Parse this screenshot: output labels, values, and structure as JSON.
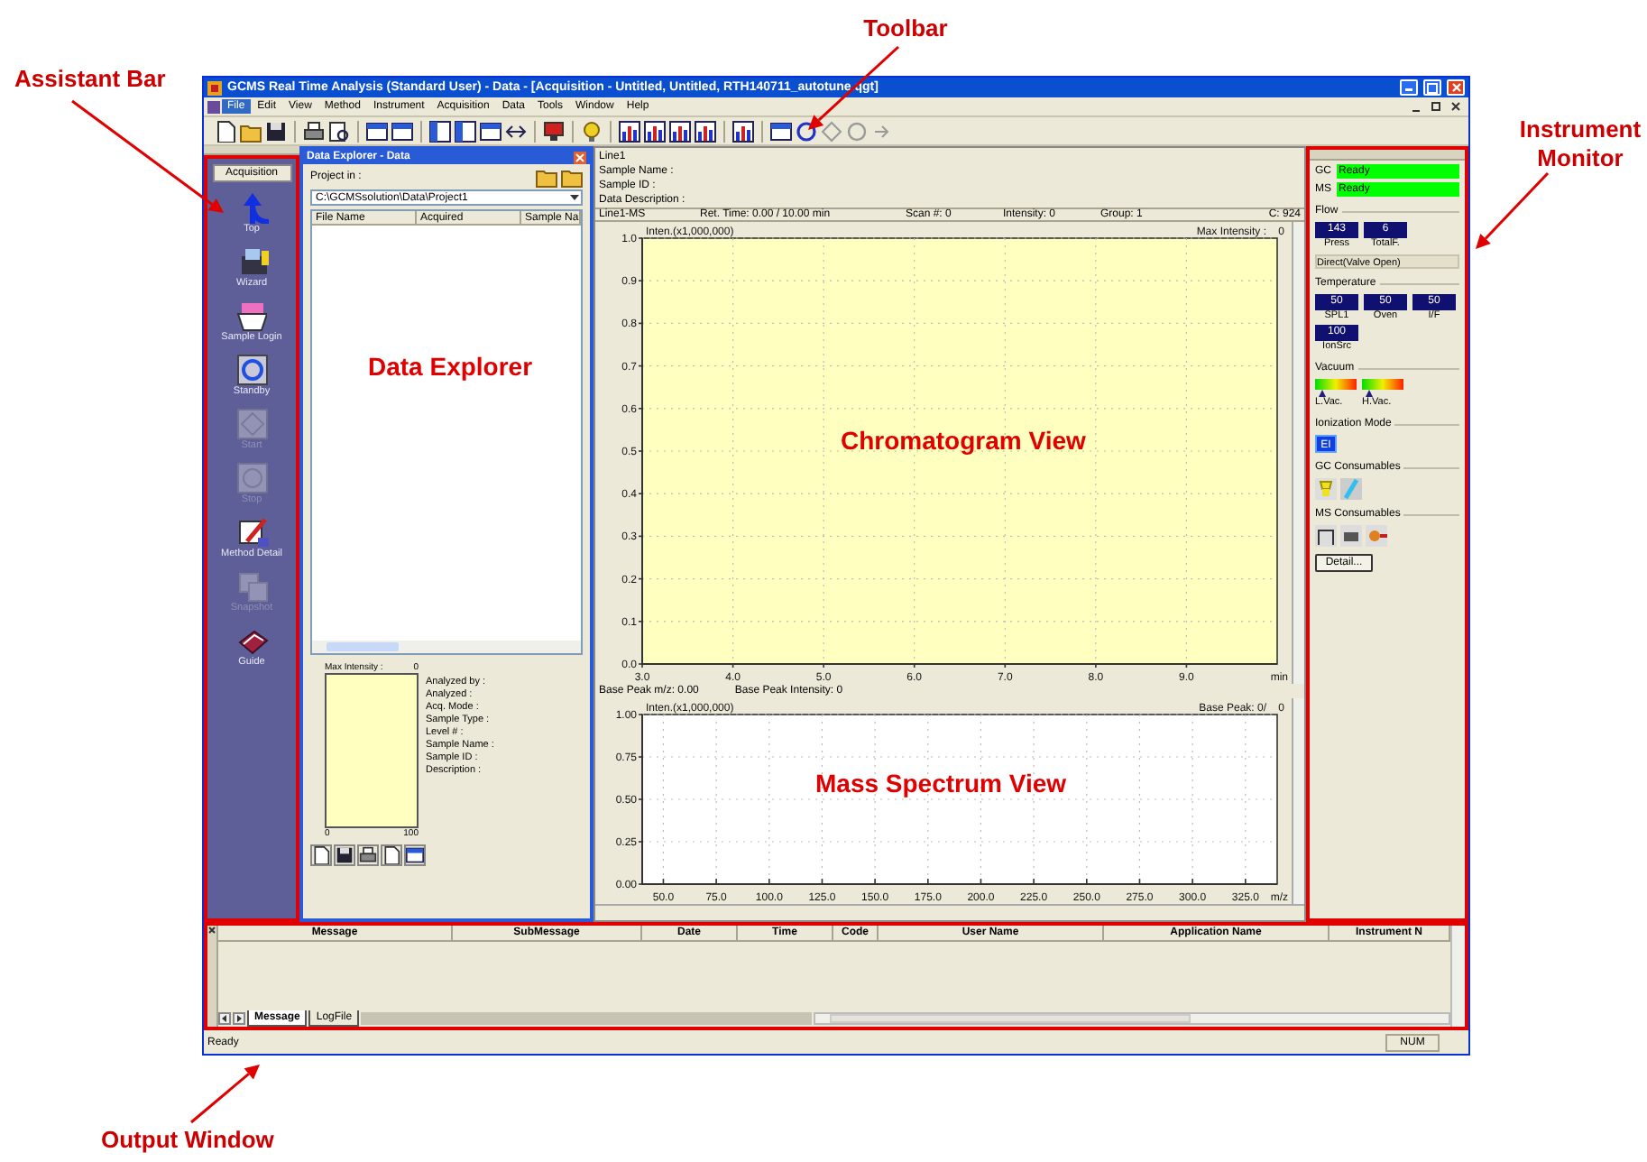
{
  "annotations": [
    {
      "text": "Assistant Bar"
    },
    {
      "text": "Toolbar"
    },
    {
      "text": "Instrument Monitor"
    },
    {
      "text": "Output Window"
    }
  ],
  "window": {
    "title": "GCMS Real Time Analysis (Standard User) - Data - [Acquisition - Untitled, Untitled, RTH140711_autotune.qgt]"
  },
  "menu": [
    {
      "label": "File",
      "selected": true
    },
    {
      "label": "Edit",
      "selected": false
    },
    {
      "label": "View",
      "selected": false
    },
    {
      "label": "Method",
      "selected": false
    },
    {
      "label": "Instrument",
      "selected": false
    },
    {
      "label": "Acquisition",
      "selected": false
    },
    {
      "label": "Data",
      "selected": false
    },
    {
      "label": "Tools",
      "selected": false
    },
    {
      "label": "Window",
      "selected": false
    },
    {
      "label": "Help",
      "selected": false
    }
  ],
  "assistant_bar": {
    "tab": "Acquisition",
    "items": [
      {
        "label": "Top",
        "disabled": false
      },
      {
        "label": "Wizard",
        "disabled": false
      },
      {
        "label": "Sample Login",
        "disabled": false
      },
      {
        "label": "Standby",
        "disabled": false
      },
      {
        "label": "Start",
        "disabled": true
      },
      {
        "label": "Stop",
        "disabled": true
      },
      {
        "label": "Method Detail",
        "disabled": false
      },
      {
        "label": "Snapshot",
        "disabled": true
      },
      {
        "label": "Guide",
        "disabled": false
      }
    ]
  },
  "data_explorer": {
    "title": "Data Explorer - Data",
    "project_label": "Project in :",
    "project_path": "C:\\GCMSsolution\\Data\\Project1",
    "columns": [
      "File Name",
      "Acquired",
      "Sample Na"
    ],
    "overlay_label": "Data Explorer",
    "preview": {
      "header": "Max Intensity :",
      "value": "0",
      "x_min": "0",
      "x_max": "100"
    },
    "info": [
      "Analyzed by :",
      "Analyzed :",
      "Acq. Mode :",
      "Sample Type :",
      "Level # :",
      "Sample Name :",
      "Sample ID :",
      "Description :"
    ]
  },
  "chromatogram": {
    "header_lines": [
      "Line1",
      "Sample Name :",
      "Sample ID :",
      "Data Description :"
    ],
    "status": [
      "Line1-MS",
      "Ret. Time: 0.00 / 10.00 min",
      "Scan #: 0",
      "Intensity: 0",
      "Group: 1",
      "C: 924"
    ],
    "max_intensity_label": "Max Intensity :",
    "max_intensity": "0",
    "overlay_label": "Chromatogram View",
    "chart_data": {
      "type": "line",
      "grid": true,
      "xlabel": "min",
      "ylabel": "Inten.(x1,000,000)",
      "xlim": [
        3,
        10
      ],
      "ylim": [
        0,
        1
      ],
      "xticks": [
        {
          "value": 3,
          "label": "3.0"
        },
        {
          "value": 4,
          "label": "4.0"
        },
        {
          "value": 5,
          "label": "5.0"
        },
        {
          "value": 6,
          "label": "6.0"
        },
        {
          "value": 7,
          "label": "7.0"
        },
        {
          "value": 8,
          "label": "8.0"
        },
        {
          "value": 9,
          "label": "9.0"
        }
      ],
      "yticks": [
        {
          "value": 0,
          "label": "0.0"
        },
        {
          "value": 0.1,
          "label": "0.1"
        },
        {
          "value": 0.2,
          "label": "0.2"
        },
        {
          "value": 0.3,
          "label": "0.3"
        },
        {
          "value": 0.4,
          "label": "0.4"
        },
        {
          "value": 0.5,
          "label": "0.5"
        },
        {
          "value": 0.6,
          "label": "0.6"
        },
        {
          "value": 0.7,
          "label": "0.7"
        },
        {
          "value": 0.8,
          "label": "0.8"
        },
        {
          "value": 0.9,
          "label": "0.9"
        },
        {
          "value": 1,
          "label": "1.0"
        }
      ]
    }
  },
  "mass_spectrum": {
    "status": [
      "Base Peak m/z: 0.00",
      "Base Peak Intensity: 0"
    ],
    "base_peak_label": "Base Peak: 0/",
    "base_peak": "0",
    "overlay_label": "Mass Spectrum View",
    "chart_data": {
      "type": "bar",
      "grid": true,
      "xlabel": "m/z",
      "ylabel": "Inten.(x1,000,000)",
      "xlim": [
        40,
        340
      ],
      "ylim": [
        0,
        1
      ],
      "xticks": [
        {
          "value": 50,
          "label": "50.0"
        },
        {
          "value": 75,
          "label": "75.0"
        },
        {
          "value": 100,
          "label": "100.0"
        },
        {
          "value": 125,
          "label": "125.0"
        },
        {
          "value": 150,
          "label": "150.0"
        },
        {
          "value": 175,
          "label": "175.0"
        },
        {
          "value": 200,
          "label": "200.0"
        },
        {
          "value": 225,
          "label": "225.0"
        },
        {
          "value": 250,
          "label": "250.0"
        },
        {
          "value": 275,
          "label": "275.0"
        },
        {
          "value": 300,
          "label": "300.0"
        },
        {
          "value": 325,
          "label": "325.0"
        }
      ],
      "yticks": [
        {
          "value": 0,
          "label": "0.00"
        },
        {
          "value": 0.25,
          "label": "0.25"
        },
        {
          "value": 0.5,
          "label": "0.50"
        },
        {
          "value": 0.75,
          "label": "0.75"
        },
        {
          "value": 1,
          "label": "1.00"
        }
      ]
    }
  },
  "instrument_monitor": {
    "units": [
      {
        "label": "GC",
        "status": "Ready"
      },
      {
        "label": "MS",
        "status": "Ready"
      }
    ],
    "flow": {
      "title": "Flow",
      "values": [
        {
          "value": "143",
          "label": "Press"
        },
        {
          "value": "6",
          "label": "TotalF."
        }
      ],
      "valve": "Direct(Valve Open)"
    },
    "temperature": {
      "title": "Temperature",
      "values": [
        {
          "value": "50",
          "label": "SPL1"
        },
        {
          "value": "50",
          "label": "Oven"
        },
        {
          "value": "50",
          "label": "I/F"
        },
        {
          "value": "100",
          "label": "IonSrc"
        }
      ]
    },
    "vacuum": {
      "title": "Vacuum",
      "gauges": [
        {
          "label": "L.Vac.",
          "level": 0.1
        },
        {
          "label": "H.Vac.",
          "level": 0.1
        }
      ]
    },
    "ionization": {
      "title": "Ionization Mode",
      "mode": "EI"
    },
    "gc_consumables": "GC Consumables",
    "ms_consumables": "MS Consumables",
    "detail_button": "Detail..."
  },
  "output": {
    "columns": [
      "Message",
      "SubMessage",
      "Date",
      "Time",
      "Code",
      "User Name",
      "Application Name",
      "Instrument N"
    ],
    "tabs": [
      {
        "label": "Message",
        "selected": true
      },
      {
        "label": "LogFile",
        "selected": false
      }
    ]
  },
  "status_bar": {
    "text": "Ready",
    "indicator": "NUM"
  }
}
